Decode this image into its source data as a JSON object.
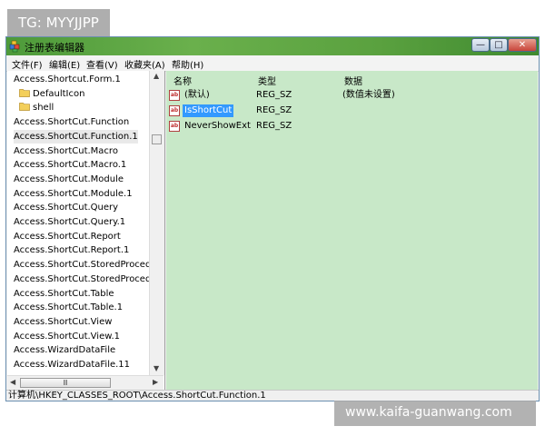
{
  "watermark_top": "TG: MYYJJPP",
  "watermark_bottom": "www.kaifa-guanwang.com",
  "window": {
    "title": "注册表编辑器",
    "buttons": {
      "minimize": "—",
      "maximize": "□",
      "close": "✕"
    }
  },
  "menu": [
    {
      "label": "文件(F)"
    },
    {
      "label": "编辑(E)"
    },
    {
      "label": "查看(V)"
    },
    {
      "label": "收藏夹(A)"
    },
    {
      "label": "帮助(H)"
    }
  ],
  "tree": {
    "items": [
      {
        "label": "Access.Shortcut.Form.1",
        "icon": "none",
        "selected": false
      },
      {
        "label": "DefaultIcon",
        "icon": "folder-icon",
        "selected": false
      },
      {
        "label": "shell",
        "icon": "folder-icon",
        "selected": false
      },
      {
        "label": "Access.ShortCut.Function",
        "icon": "none",
        "selected": false
      },
      {
        "label": "Access.ShortCut.Function.1",
        "icon": "none",
        "selected": true
      },
      {
        "label": "Access.ShortCut.Macro",
        "icon": "none",
        "selected": false
      },
      {
        "label": "Access.ShortCut.Macro.1",
        "icon": "none",
        "selected": false
      },
      {
        "label": "Access.ShortCut.Module",
        "icon": "none",
        "selected": false
      },
      {
        "label": "Access.ShortCut.Module.1",
        "icon": "none",
        "selected": false
      },
      {
        "label": "Access.ShortCut.Query",
        "icon": "none",
        "selected": false
      },
      {
        "label": "Access.ShortCut.Query.1",
        "icon": "none",
        "selected": false
      },
      {
        "label": "Access.ShortCut.Report",
        "icon": "none",
        "selected": false
      },
      {
        "label": "Access.ShortCut.Report.1",
        "icon": "none",
        "selected": false
      },
      {
        "label": "Access.ShortCut.StoredProcedure",
        "icon": "none",
        "selected": false
      },
      {
        "label": "Access.ShortCut.StoredProcedure",
        "icon": "none",
        "selected": false
      },
      {
        "label": "Access.ShortCut.Table",
        "icon": "none",
        "selected": false
      },
      {
        "label": "Access.ShortCut.Table.1",
        "icon": "none",
        "selected": false
      },
      {
        "label": "Access.ShortCut.View",
        "icon": "none",
        "selected": false
      },
      {
        "label": "Access.ShortCut.View.1",
        "icon": "none",
        "selected": false
      },
      {
        "label": "Access.WizardDataFile",
        "icon": "none",
        "selected": false
      },
      {
        "label": "Access.WizardDataFile.11",
        "icon": "none",
        "selected": false
      }
    ],
    "scroll_thumb_grip": "Ⅲ"
  },
  "columns": {
    "name": "名称",
    "type": "类型",
    "data": "数据"
  },
  "values": [
    {
      "name": "(默认)",
      "type": "REG_SZ",
      "data": "(数值未设置)",
      "icon": "ab-string-icon",
      "selected": false
    },
    {
      "name": "IsShortCut",
      "type": "REG_SZ",
      "data": "",
      "icon": "ab-string-icon",
      "selected": true
    },
    {
      "name": "NeverShowExt",
      "type": "REG_SZ",
      "data": "",
      "icon": "ab-string-icon",
      "selected": false
    }
  ],
  "status_path": "计算机\\HKEY_CLASSES_ROOT\\Access.ShortCut.Function.1",
  "colors": {
    "list_background": "#c8e8c8",
    "selection_blue": "#3399ff",
    "titlebar_green": "#5aa13f"
  }
}
